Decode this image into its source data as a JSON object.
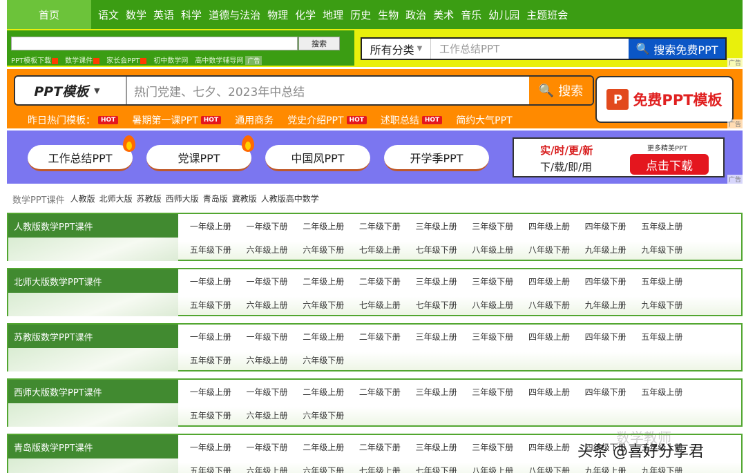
{
  "nav": {
    "home": "首页",
    "items": [
      "语文",
      "数学",
      "英语",
      "科学",
      "道德与法治",
      "物理",
      "化学",
      "地理",
      "历史",
      "生物",
      "政治",
      "美术",
      "音乐",
      "幼儿园",
      "主题班会"
    ]
  },
  "row2": {
    "search_button": "搜索",
    "links": [
      "PPT模板下载",
      "数学课件",
      "家长会PPT",
      "初中数学网",
      "高中数学辅导网"
    ],
    "ad_tag": "广告",
    "category": "所有分类",
    "placeholder": "工作总结PPT",
    "search_free": "搜索免费PPT",
    "ad_label": "广告"
  },
  "row3": {
    "category": "PPT模板",
    "placeholder": "热门党建、七夕、2023年中总结",
    "search": "搜索",
    "free_ppt": "免费PPT模板",
    "links": [
      {
        "label": "昨日热门模板：",
        "hot": "HOT"
      },
      {
        "label": "暑期第一课PPT",
        "hot": "HOT"
      },
      {
        "label": "通用商务",
        "hot": ""
      },
      {
        "label": "党史介绍PPT",
        "hot": "HOT"
      },
      {
        "label": "述职总结",
        "hot": "HOT"
      },
      {
        "label": "简约大气PPT",
        "hot": ""
      }
    ],
    "ad_label": "广告"
  },
  "row4": {
    "pills": [
      "工作总结PPT",
      "党课PPT",
      "中国风PPT",
      "开学季PPT"
    ],
    "ad_line1": "实/时/更/新",
    "ad_line2": "下/载/即/用",
    "ad_more": "更多精美PPT",
    "ad_download": "点击下载",
    "ad_label": "广告"
  },
  "crumbs": [
    "数学PPT课件",
    "人教版",
    "北师大版",
    "苏教版",
    "西师大版",
    "青岛版",
    "冀教版",
    "人教版高中数学"
  ],
  "sections": [
    {
      "title": "人教版数学PPT课件",
      "grades": [
        "一年级上册",
        "一年级下册",
        "二年级上册",
        "二年级下册",
        "三年级上册",
        "三年级下册",
        "四年级上册",
        "四年级下册",
        "五年级上册",
        "五年级下册",
        "六年级上册",
        "六年级下册",
        "七年级上册",
        "七年级下册",
        "八年级上册",
        "八年级下册",
        "九年级上册",
        "九年级下册"
      ]
    },
    {
      "title": "北师大版数学PPT课件",
      "grades": [
        "一年级上册",
        "一年级下册",
        "二年级上册",
        "二年级下册",
        "三年级上册",
        "三年级下册",
        "四年级上册",
        "四年级下册",
        "五年级上册",
        "五年级下册",
        "六年级上册",
        "六年级下册",
        "七年级上册",
        "七年级下册",
        "八年级上册",
        "八年级下册",
        "九年级上册",
        "九年级下册"
      ]
    },
    {
      "title": "苏教版数学PPT课件",
      "grades": [
        "一年级上册",
        "一年级下册",
        "二年级上册",
        "二年级下册",
        "三年级上册",
        "三年级下册",
        "四年级上册",
        "四年级下册",
        "五年级上册",
        "五年级下册",
        "六年级上册",
        "六年级下册"
      ]
    },
    {
      "title": "西师大版数学PPT课件",
      "grades": [
        "一年级上册",
        "一年级下册",
        "二年级上册",
        "二年级下册",
        "三年级上册",
        "三年级下册",
        "四年级上册",
        "四年级下册",
        "五年级上册",
        "五年级下册",
        "六年级上册",
        "六年级下册"
      ]
    },
    {
      "title": "青岛版数学PPT课件",
      "grades": [
        "一年级上册",
        "一年级下册",
        "二年级上册",
        "二年级下册",
        "三年级上册",
        "三年级下册",
        "四年级上册",
        "四年级下册",
        "五年级上册",
        "五年级下册",
        "六年级上册",
        "六年级下册",
        "七年级上册",
        "七年级下册",
        "八年级上册",
        "八年级下册",
        "九年级上册",
        "九年级下册"
      ]
    }
  ],
  "watermark": {
    "text": "头条 @喜好分享君",
    "ghost": "数学教师"
  }
}
